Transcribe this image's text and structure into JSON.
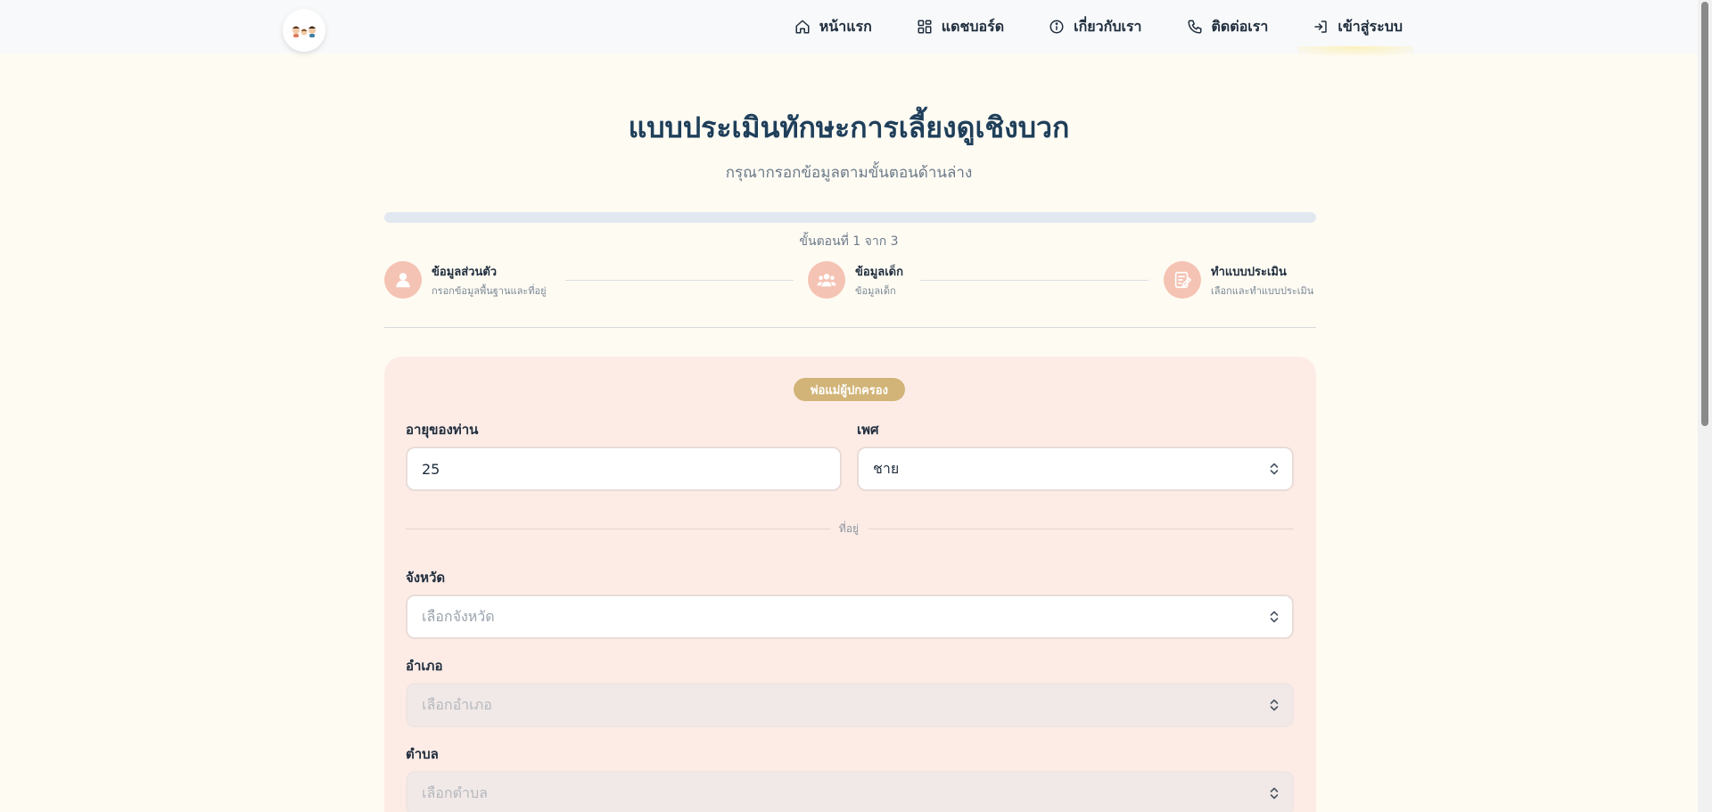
{
  "nav": {
    "items": [
      {
        "label": "หน้าแรก",
        "icon": "home-icon"
      },
      {
        "label": "แดชบอร์ด",
        "icon": "dashboard-icon"
      },
      {
        "label": "เกี่ยวกับเรา",
        "icon": "info-icon"
      },
      {
        "label": "ติดต่อเรา",
        "icon": "phone-icon"
      },
      {
        "label": "เข้าสู่ระบบ",
        "icon": "login-icon"
      }
    ]
  },
  "header": {
    "title": "แบบประเมินทักษะการเลี้ยงดูเชิงบวก",
    "subtitle": "กรุณากรอกข้อมูลตามขั้นตอนด้านล่าง"
  },
  "progress": {
    "fraction": 0.0,
    "counter_text": "ขั้นตอนที่ 1 จาก 3"
  },
  "steps": [
    {
      "title": "ข้อมูลส่วนตัว",
      "desc": "กรอกข้อมูลพื้นฐานและที่อยู่",
      "icon": "user-icon"
    },
    {
      "title": "ข้อมูลเด็ก",
      "desc": "ข้อมูลเด็ก",
      "icon": "group-icon"
    },
    {
      "title": "ทำแบบประเมิน",
      "desc": "เลือกและทำแบบประเมิน",
      "icon": "checklist-icon"
    }
  ],
  "form": {
    "role_badge": "พ่อแม่ผู้ปกครอง",
    "age": {
      "label": "อายุของท่าน",
      "value": "25"
    },
    "gender": {
      "label": "เพศ",
      "value": "ชาย"
    },
    "address_separator": "ที่อยู่",
    "province": {
      "label": "จังหวัด",
      "placeholder": "เลือกจังหวัด"
    },
    "district": {
      "label": "อำเภอ",
      "placeholder": "เลือกอำเภอ"
    },
    "subdistrict": {
      "label": "ตำบล",
      "placeholder": "เลือกตำบล"
    }
  },
  "colors": {
    "background": "#fefbf3",
    "accent_peach": "#f5c3b3",
    "badge_gold": "#d2b478",
    "title_navy": "#1f3f5a",
    "card_bg": "#fdece6"
  }
}
